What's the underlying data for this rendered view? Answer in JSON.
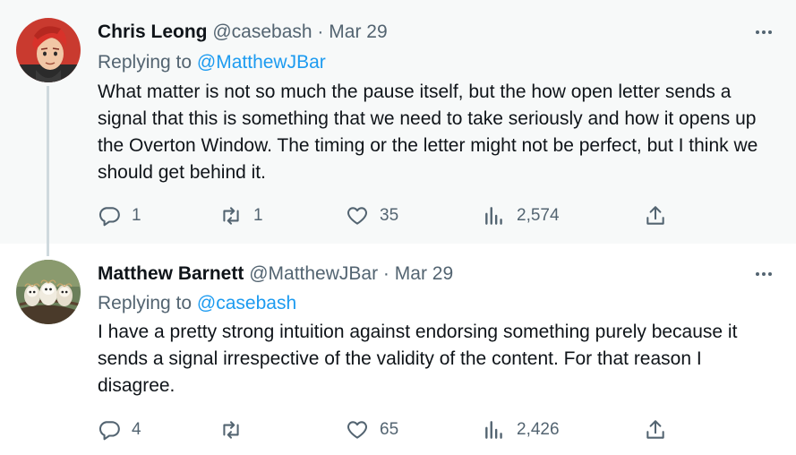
{
  "tweets": [
    {
      "author_name": "Chris Leong",
      "handle": "@casebash",
      "separator": "·",
      "date": "Mar 29",
      "replying_prefix": "Replying to",
      "replying_to": "@MatthewJBar",
      "text": "What matter is not so much the pause itself, but the how open letter sends a signal that this is something that we need to take seriously and how it opens up the Overton Window. The timing or the letter might not be perfect, but I think we should get behind it.",
      "replies": "1",
      "retweets": "1",
      "likes": "35",
      "views": "2,574",
      "avatar_icon": "cartoon-red-haired-man-avatar"
    },
    {
      "author_name": "Matthew Barnett",
      "handle": "@MatthewJBar",
      "separator": "·",
      "date": "Mar 29",
      "replying_prefix": "Replying to",
      "replying_to": "@casebash",
      "text": "I have a pretty strong intuition against endorsing something purely because it sends a signal irrespective of the validity of the content. For that reason I disagree.",
      "replies": "4",
      "retweets": "",
      "likes": "65",
      "views": "2,426",
      "avatar_icon": "three-owls-painting-avatar"
    }
  ],
  "icons": {
    "reply": "reply-icon",
    "retweet": "retweet-icon",
    "like": "heart-icon",
    "views": "analytics-icon",
    "share": "share-icon",
    "more": "more-dots-icon"
  },
  "colors": {
    "accent": "#1d9bf0",
    "secondary_text": "#536471",
    "primary_text": "#0f1419",
    "highlight_bg": "#f7f9f9",
    "thread_line": "#cfd9de"
  }
}
